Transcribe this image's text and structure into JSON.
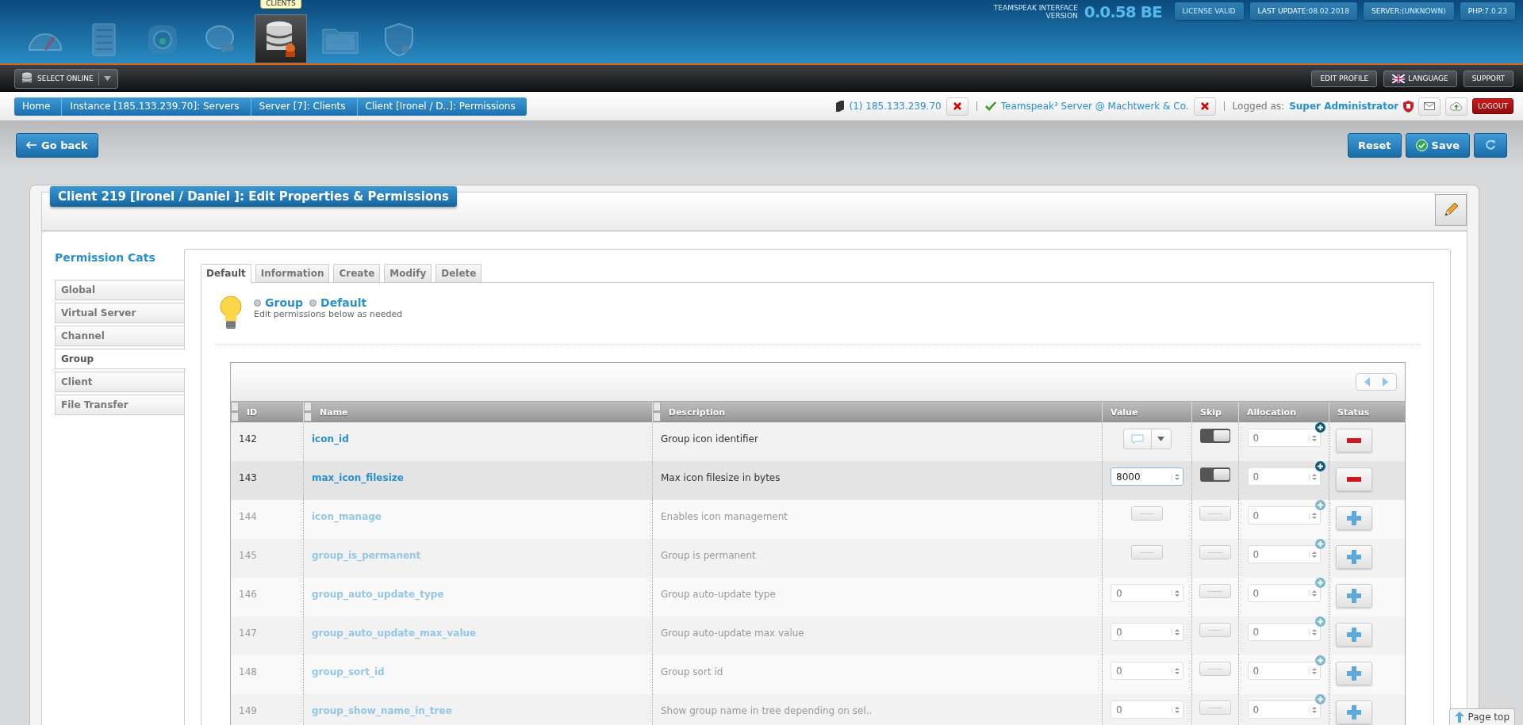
{
  "header": {
    "nav_tooltip": "CLIENTS",
    "nav_icons": [
      {
        "selected": false
      },
      {
        "selected": false
      },
      {
        "selected": false
      },
      {
        "selected": false
      },
      {
        "selected": true
      },
      {
        "selected": false
      },
      {
        "selected": false
      }
    ],
    "version_label_1": "TEAMSPEAK INTERFACE",
    "version_label_2": "VERSION",
    "version": "0.0.58 BE",
    "badges": [
      {
        "label": "LICENSE VALID"
      },
      {
        "label": "LAST UPDATE:",
        "value": "08.02.2018"
      },
      {
        "label": "SERVER:",
        "value": "(UNKNOWN)"
      },
      {
        "label": "PHP:",
        "value": "7.0.23"
      }
    ]
  },
  "navbar": {
    "select_online": "SELECT ONLINE",
    "buttons": [
      {
        "label": "EDIT PROFILE",
        "kind": "plain"
      },
      {
        "label": "LANGUAGE",
        "kind": "flag"
      },
      {
        "label": "SUPPORT",
        "kind": "plain"
      }
    ]
  },
  "breadcrumb": [
    "Home",
    "Instance [185.133.239.70]: Servers",
    "Server [7]: Clients",
    "Client [Ironel / D..]: Permissions"
  ],
  "connection": {
    "instance": "(1) 185.133.239.70",
    "server": "Teamspeak³ Server @ Machtwerk & Co.",
    "logged_label": "Logged as:",
    "user": "Super Administrator",
    "logout": "LOGOUT"
  },
  "toolbar": {
    "back": "Go back",
    "reset": "Reset",
    "save": "Save"
  },
  "panel": {
    "title": "Client 219 [Ironel / Daniel ]: Edit Properties & Permissions",
    "sidebar_title": "Permission Cats",
    "categories": [
      {
        "label": "Global",
        "selected": false
      },
      {
        "label": "Virtual Server",
        "selected": false
      },
      {
        "label": "Channel",
        "selected": false
      },
      {
        "label": "Group",
        "selected": true
      },
      {
        "label": "Client",
        "selected": false
      },
      {
        "label": "File Transfer",
        "selected": false
      }
    ],
    "tabs": [
      {
        "label": "Default",
        "selected": true
      },
      {
        "label": "Information",
        "selected": false
      },
      {
        "label": "Create",
        "selected": false
      },
      {
        "label": "Modify",
        "selected": false
      },
      {
        "label": "Delete",
        "selected": false
      }
    ],
    "info": {
      "crumb_1": "Group",
      "crumb_2": "Default",
      "hint": "Edit permissions below as needed"
    },
    "table": {
      "columns": [
        "ID",
        "Name",
        "Description",
        "Value",
        "Skip",
        "Allocation",
        "Status"
      ],
      "rows": [
        {
          "id": "142",
          "name": "icon_id",
          "description": "Group icon identifier",
          "active": true,
          "selected": false,
          "kind": "icon",
          "allocation": "0"
        },
        {
          "id": "143",
          "name": "max_icon_filesize",
          "description": "Max icon filesize in bytes",
          "active": true,
          "selected": true,
          "kind": "number",
          "value": "8000",
          "allocation": "0"
        },
        {
          "id": "144",
          "name": "icon_manage",
          "description": "Enables icon management",
          "active": false,
          "selected": false,
          "kind": "toggle",
          "allocation": "0"
        },
        {
          "id": "145",
          "name": "group_is_permanent",
          "description": "Group is permanent",
          "active": false,
          "selected": false,
          "kind": "toggle",
          "allocation": "0"
        },
        {
          "id": "146",
          "name": "group_auto_update_type",
          "description": "Group auto-update type",
          "active": false,
          "selected": false,
          "kind": "number",
          "value": "0",
          "allocation": "0"
        },
        {
          "id": "147",
          "name": "group_auto_update_max_value",
          "description": "Group auto-update max value",
          "active": false,
          "selected": false,
          "kind": "number",
          "value": "0",
          "allocation": "0"
        },
        {
          "id": "148",
          "name": "group_sort_id",
          "description": "Group sort id",
          "active": false,
          "selected": false,
          "kind": "number",
          "value": "0",
          "allocation": "0"
        },
        {
          "id": "149",
          "name": "group_show_name_in_tree",
          "description": "Show group name in tree depending on sel..",
          "active": false,
          "selected": false,
          "kind": "number",
          "value": "0",
          "allocation": "0"
        }
      ]
    }
  },
  "page_top": "Page top"
}
